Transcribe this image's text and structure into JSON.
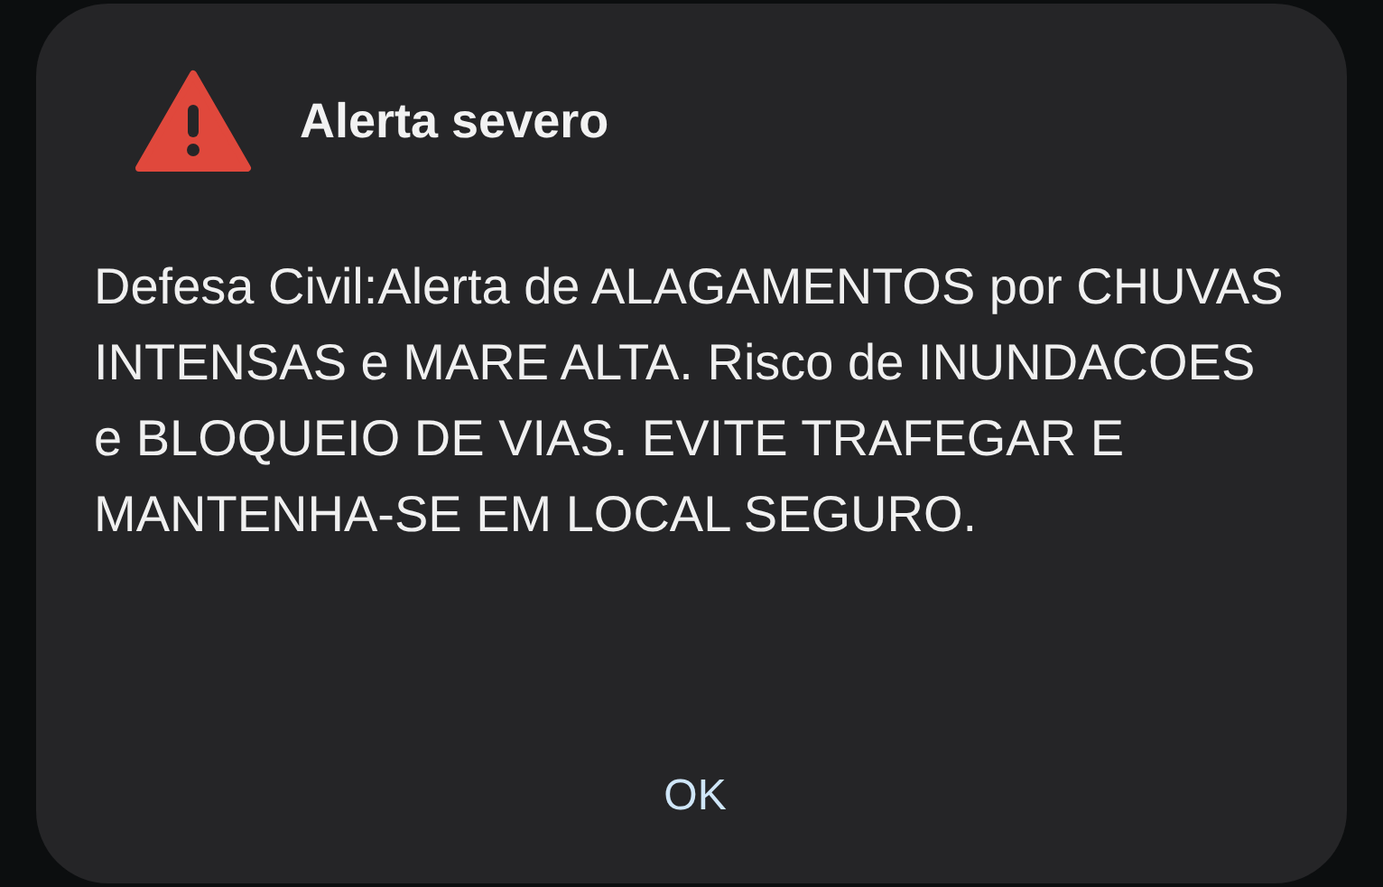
{
  "dialog": {
    "title": "Alerta severo",
    "message": "Defesa Civil:Alerta de ALAGAMENTOS por CHUVAS INTENSAS e MARE ALTA. Risco de INUNDACOES e BLOQUEIO DE VIAS. EVITE TRAFEGAR E MANTENHA-SE EM LOCAL SEGURO.",
    "buttons": [
      "OK"
    ]
  }
}
